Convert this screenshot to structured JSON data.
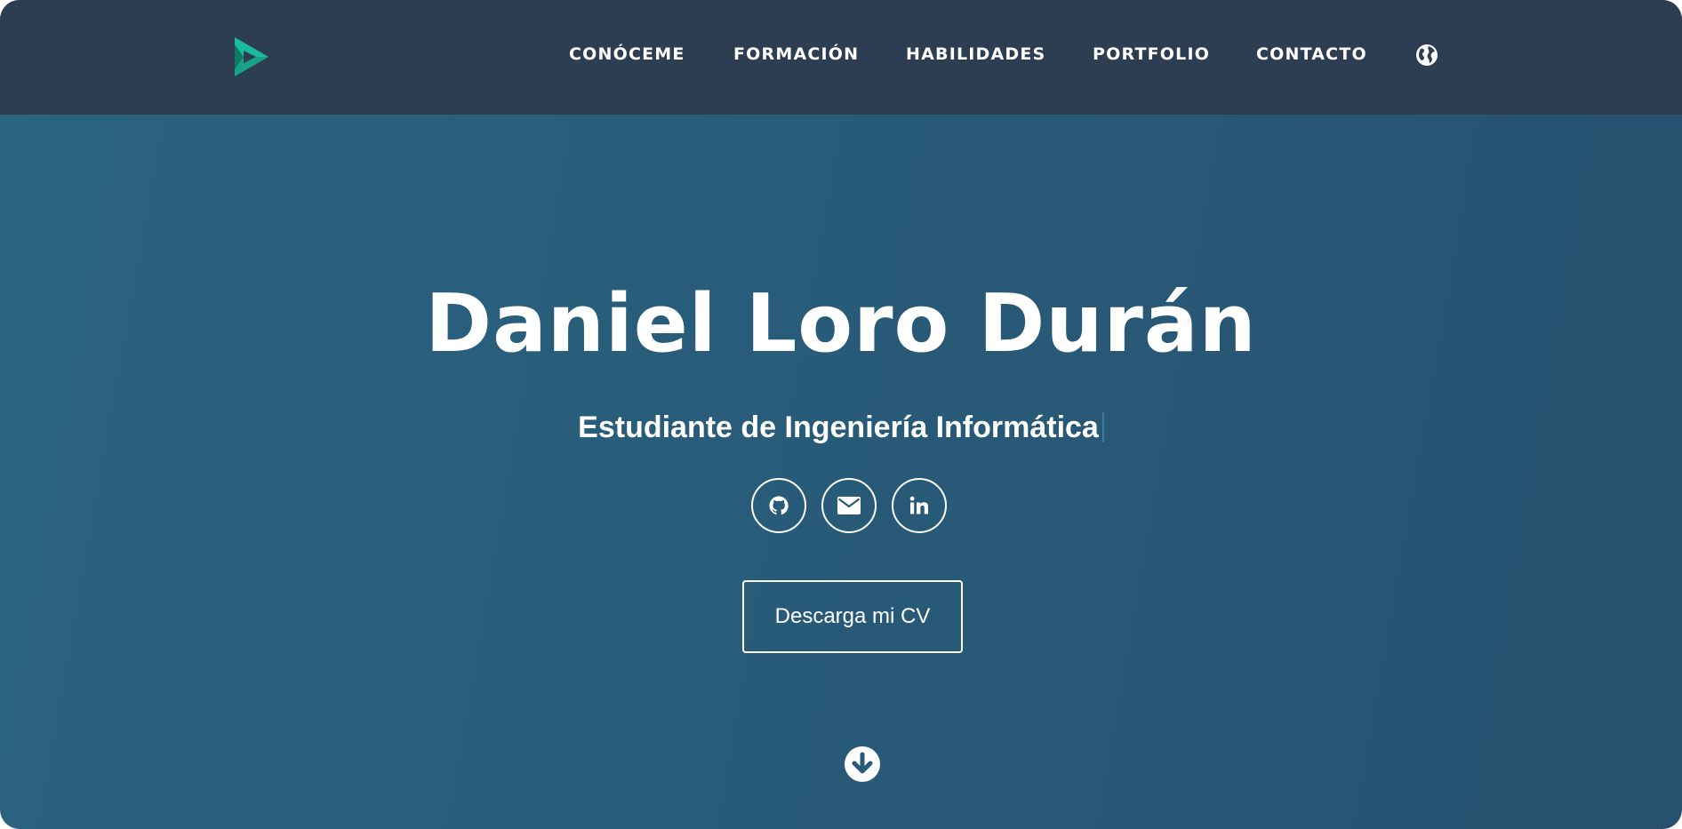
{
  "nav": {
    "logo": "play-logo-icon",
    "items": [
      {
        "label": "CONÓCEME"
      },
      {
        "label": "FORMACIÓN"
      },
      {
        "label": "HABILIDADES"
      },
      {
        "label": "PORTFOLIO"
      },
      {
        "label": "CONTACTO"
      }
    ],
    "language_icon": "globe-icon"
  },
  "hero": {
    "name": "Daniel Loro Durán",
    "subtitle": "Estudiante de Ingeniería Informática",
    "social": [
      {
        "icon": "github-icon"
      },
      {
        "icon": "envelope-icon"
      },
      {
        "icon": "linkedin-icon"
      }
    ],
    "cv_button": "Descarga mi CV",
    "scroll_icon": "arrow-down-circle-icon"
  },
  "colors": {
    "navbar": "#2e3e52",
    "hero_gradient_start": "#2a6480",
    "hero_gradient_end": "#27516f",
    "logo_green": "#16a085",
    "text": "#ffffff"
  }
}
